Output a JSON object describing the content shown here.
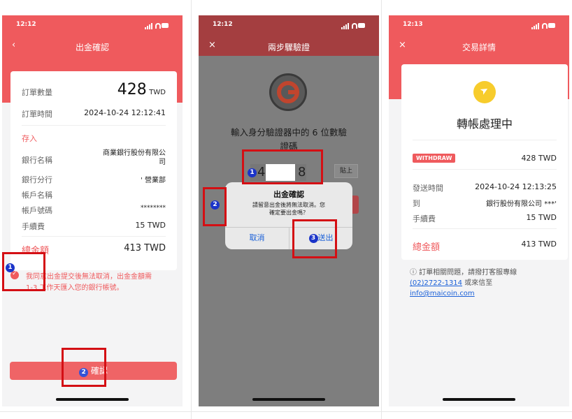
{
  "status": {
    "s1_time": "12:12",
    "s2_time": "12:12",
    "s3_time": "12:13"
  },
  "screen1": {
    "title": "出金確認",
    "back_icon": "‹",
    "qty_label": "訂單數量",
    "qty_value": "428",
    "qty_unit": "TWD",
    "time_label": "訂單時間",
    "time_value": "2024-10-24 12:12:41",
    "section": "存入",
    "bank_label": "銀行名稱",
    "bank_value_l1": "商業銀行股份有限公",
    "bank_value_l2": "司",
    "branch_label": "銀行分行",
    "branch_value": "' 營業部",
    "acct_name_label": "帳戶名稱",
    "acct_no_label": "帳戶號碼",
    "acct_no_value": "********",
    "fee_label": "手續費",
    "fee_value": "15 TWD",
    "total_label": "總金額",
    "total_value": "413 TWD",
    "agree_l1": "我同意出金提交後無法取消，出金金額需",
    "agree_l2": "1-3 工作天匯入您的銀行帳號。",
    "confirm_label": "確認",
    "step1": "1",
    "step2": "2"
  },
  "screen2": {
    "title": "兩步驟驗證",
    "close_icon": "×",
    "prompt_l1": "輸入身分驗證器中的 6 位數驗",
    "prompt_l2": "證碼",
    "code_first": "4",
    "code_last": "8",
    "paste_label": "貼上",
    "dialog_title": "出金確認",
    "dialog_msg_l1": "請留意出金後將無法取消。您",
    "dialog_msg_l2": "確定要出金嗎？",
    "cancel_label": "取消",
    "send_label": "送出",
    "step1": "1",
    "step2": "2",
    "step3": "3"
  },
  "screen3": {
    "title": "交易詳情",
    "close_icon": "×",
    "status": "轉帳處理中",
    "badge": "WITHDRAW",
    "amount": "428 TWD",
    "sent_label": "發送時間",
    "sent_value": "2024-10-24 12:13:25",
    "to_label": "到",
    "to_value": "銀行股份有限公司 ***'",
    "fee_label": "手續費",
    "fee_value": "15 TWD",
    "total_label": "總金額",
    "total_value": "413 TWD",
    "help_l1": "ⓘ 訂單相關問題，請撥打客服專線",
    "phone": "(02)2722-1314",
    "help_l2": " 或來信至",
    "email": "info@maicoin.com"
  },
  "colors": {
    "brand": "#ef5a5d",
    "annotation": "#d40f14",
    "step_badge": "#1b34c9",
    "dialog_btn": "#1a60d8"
  }
}
